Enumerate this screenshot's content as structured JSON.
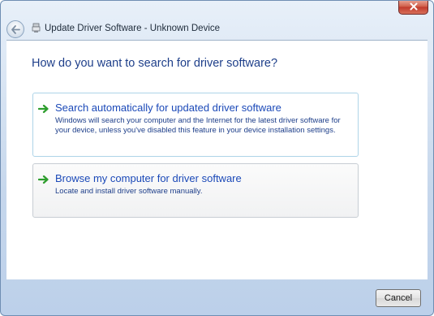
{
  "window": {
    "title": "Update Driver Software - Unknown Device",
    "back_icon": "back-arrow-icon",
    "device_icon": "device-icon",
    "close_icon": "close-x-icon"
  },
  "main": {
    "heading": "How do you want to search for driver software?",
    "options": [
      {
        "icon": "green-arrow-icon",
        "title": "Search automatically for updated driver software",
        "description": "Windows will search your computer and the Internet for the latest driver software for your device, unless you've disabled this feature in your device installation settings."
      },
      {
        "icon": "green-arrow-icon",
        "title": "Browse my computer for driver software",
        "description": "Locate and install driver software manually."
      }
    ]
  },
  "footer": {
    "cancel_label": "Cancel"
  },
  "colors": {
    "heading": "#1e3f8a",
    "option_title": "#1b49b8",
    "arrow_green": "#2e9e2e",
    "close_red": "#c0392b"
  }
}
